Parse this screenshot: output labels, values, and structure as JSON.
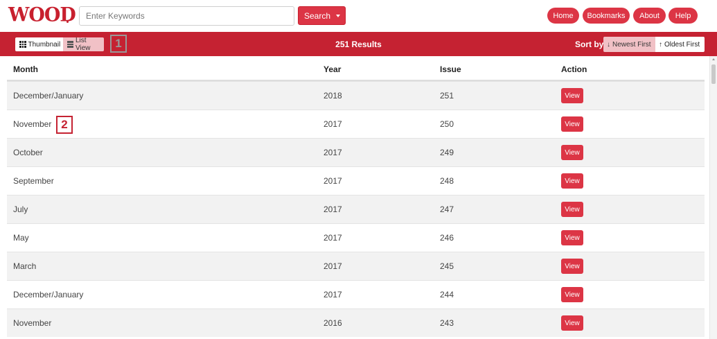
{
  "header": {
    "logo": "WOOD",
    "search_placeholder": "Enter Keywords",
    "search_label": "Search",
    "nav": [
      "Home",
      "Bookmarks",
      "About",
      "Help"
    ]
  },
  "results_bar": {
    "thumbnail_label": "Thumbnail",
    "list_view_label": "List View",
    "count_text": "251 Results",
    "sort_by_label": "Sort by",
    "newest_first_label": "Newest First",
    "oldest_first_label": "Oldest First",
    "active_view": "List View",
    "active_sort": "Newest First"
  },
  "markers": [
    "1",
    "2"
  ],
  "table": {
    "headers": [
      "Month",
      "Year",
      "Issue",
      "Action"
    ],
    "rows": [
      {
        "month": "December/January",
        "year": "2018",
        "issue": "251",
        "action": "View"
      },
      {
        "month": "November",
        "year": "2017",
        "issue": "250",
        "action": "View"
      },
      {
        "month": "October",
        "year": "2017",
        "issue": "249",
        "action": "View"
      },
      {
        "month": "September",
        "year": "2017",
        "issue": "248",
        "action": "View"
      },
      {
        "month": "July",
        "year": "2017",
        "issue": "247",
        "action": "View"
      },
      {
        "month": "May",
        "year": "2017",
        "issue": "246",
        "action": "View"
      },
      {
        "month": "March",
        "year": "2017",
        "issue": "245",
        "action": "View"
      },
      {
        "month": "December/January",
        "year": "2017",
        "issue": "244",
        "action": "View"
      },
      {
        "month": "November",
        "year": "2016",
        "issue": "243",
        "action": "View"
      }
    ]
  },
  "colors": {
    "brand_red": "#c8202e",
    "button_red": "#dc3545",
    "bar_red": "#c52232",
    "active_pink": "#f1c1c6"
  },
  "icons": [
    "grid-icon",
    "list-icon",
    "arrow-down-icon",
    "arrow-up-icon",
    "caret-down-icon"
  ]
}
